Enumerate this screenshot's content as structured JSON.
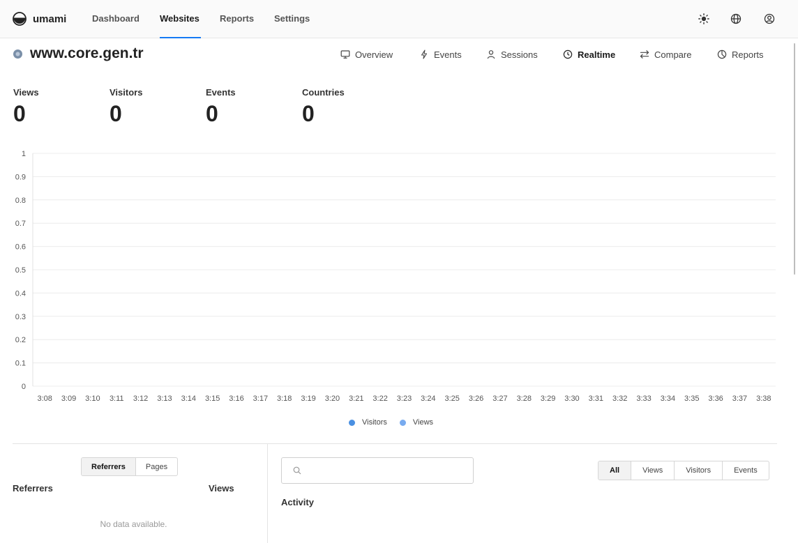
{
  "app": {
    "name": "umami"
  },
  "nav": {
    "links": [
      "Dashboard",
      "Websites",
      "Reports",
      "Settings"
    ],
    "active": "Websites",
    "icons": [
      "sun-icon",
      "globe-icon",
      "profile-icon"
    ]
  },
  "website": {
    "title": "www.core.gen.tr",
    "tabs": [
      {
        "label": "Overview",
        "icon": "monitor-icon"
      },
      {
        "label": "Events",
        "icon": "bolt-icon"
      },
      {
        "label": "Sessions",
        "icon": "user-icon"
      },
      {
        "label": "Realtime",
        "icon": "clock-icon"
      },
      {
        "label": "Compare",
        "icon": "arrows-icon"
      },
      {
        "label": "Reports",
        "icon": "pie-icon"
      }
    ],
    "active_tab": "Realtime"
  },
  "metrics": [
    {
      "label": "Views",
      "value": "0"
    },
    {
      "label": "Visitors",
      "value": "0"
    },
    {
      "label": "Events",
      "value": "0"
    },
    {
      "label": "Countries",
      "value": "0"
    }
  ],
  "chart_data": {
    "type": "bar",
    "categories": [
      "3:08",
      "3:09",
      "3:10",
      "3:11",
      "3:12",
      "3:13",
      "3:14",
      "3:15",
      "3:16",
      "3:17",
      "3:18",
      "3:19",
      "3:20",
      "3:21",
      "3:22",
      "3:23",
      "3:24",
      "3:25",
      "3:26",
      "3:27",
      "3:28",
      "3:29",
      "3:30",
      "3:31",
      "3:32",
      "3:33",
      "3:34",
      "3:35",
      "3:36",
      "3:37",
      "3:38"
    ],
    "series": [
      {
        "name": "Visitors",
        "color": "#4a90e2",
        "values": [
          0,
          0,
          0,
          0,
          0,
          0,
          0,
          0,
          0,
          0,
          0,
          0,
          0,
          0,
          0,
          0,
          0,
          0,
          0,
          0,
          0,
          0,
          0,
          0,
          0,
          0,
          0,
          0,
          0,
          0,
          0
        ]
      },
      {
        "name": "Views",
        "color": "#78abef",
        "values": [
          0,
          0,
          0,
          0,
          0,
          0,
          0,
          0,
          0,
          0,
          0,
          0,
          0,
          0,
          0,
          0,
          0,
          0,
          0,
          0,
          0,
          0,
          0,
          0,
          0,
          0,
          0,
          0,
          0,
          0,
          0
        ]
      }
    ],
    "yticks": [
      "0",
      "0.1",
      "0.2",
      "0.3",
      "0.4",
      "0.5",
      "0.6",
      "0.7",
      "0.8",
      "0.9",
      "1"
    ],
    "ylim": [
      0,
      1
    ],
    "grid": true,
    "legend": "bottom-center"
  },
  "referrers": {
    "toggle": [
      "Referrers",
      "Pages"
    ],
    "active": "Referrers",
    "col_name": "Referrers",
    "col_views": "Views",
    "empty": "No data available."
  },
  "activity": {
    "search_placeholder": "",
    "filters": [
      "All",
      "Views",
      "Visitors",
      "Events"
    ],
    "active_filter": "All",
    "title": "Activity"
  }
}
